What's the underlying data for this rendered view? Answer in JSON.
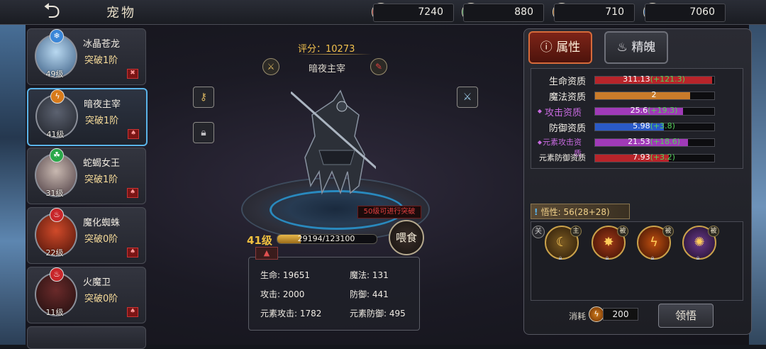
{
  "header": {
    "back_icon": "back-arrow-icon",
    "title": "宠物",
    "resources": [
      {
        "icon": "red-gem-icon",
        "color": "#c8262a",
        "value": "7240"
      },
      {
        "icon": "green-gem-icon",
        "color": "#2aa84a",
        "value": "880"
      },
      {
        "icon": "orange-bolt-icon",
        "color": "#d87a1a",
        "value": "710"
      },
      {
        "icon": "blue-snowflake-icon",
        "color": "#3a86d8",
        "value": "7060"
      }
    ]
  },
  "pets": [
    {
      "name": "冰晶苍龙",
      "breakthrough": "突破1阶",
      "level": "49级",
      "element_icon": "ice-icon",
      "element_color": "#3a86d8",
      "selected": false
    },
    {
      "name": "暗夜主宰",
      "breakthrough": "突破1阶",
      "level": "41级",
      "element_icon": "lightning-icon",
      "element_color": "#d87a1a",
      "selected": true
    },
    {
      "name": "蛇蝎女王",
      "breakthrough": "突破1阶",
      "level": "31级",
      "element_icon": "poison-icon",
      "element_color": "#2aa84a",
      "selected": false
    },
    {
      "name": "魔化蜘蛛",
      "breakthrough": "突破0阶",
      "level": "22级",
      "element_icon": "fire-icon",
      "element_color": "#c8262a",
      "selected": false
    },
    {
      "name": "火魔卫",
      "breakthrough": "突破0阶",
      "level": "11级",
      "element_icon": "fire-icon",
      "element_color": "#c8262a",
      "selected": false
    }
  ],
  "center": {
    "score": "评分：10273",
    "pet_name": "暗夜主宰",
    "weapon_icon_left": "sword-medal-icon",
    "weapon_icon_right": "red-claw-medal-icon",
    "key_icon": "key-icon",
    "lock_icon": "padlock-icon",
    "blade_icon": "blade-icon",
    "warning": "50级可进行突破",
    "level": "41级",
    "xp_text": "29194/123100",
    "xp_progress": 0.237,
    "feed_label": "喂食",
    "stats": [
      {
        "label": "生命: 19651"
      },
      {
        "label": "魔法: 131"
      },
      {
        "label": "攻击: 2000"
      },
      {
        "label": "防御: 441"
      },
      {
        "label": "元素攻击: 1782"
      },
      {
        "label": "元素防御: 495"
      }
    ]
  },
  "right": {
    "tab_attr": "属性",
    "tab_soul": "精魄",
    "attributes": [
      {
        "label": "生命资质",
        "base": "311.13",
        "plus": "(+121.3)",
        "fill": 0.98,
        "color": "#b8242a",
        "diamond": false,
        "small": false
      },
      {
        "label": "魔法资质",
        "base": "2",
        "plus": "",
        "fill": 0.8,
        "color": "#c97b2a",
        "diamond": false,
        "small": false
      },
      {
        "label": "攻击资质",
        "base": "25.6",
        "plus": "(+19.3)",
        "fill": 0.74,
        "color": "#a03ab8",
        "diamond": true,
        "small": false
      },
      {
        "label": "防御资质",
        "base": "5.98",
        "plus": "(+3.8)",
        "fill": 0.58,
        "color": "#2a5ac8",
        "diamond": false,
        "small": false
      },
      {
        "label": "元素攻击资质",
        "base": "21.53",
        "plus": "(+18.6)",
        "fill": 0.78,
        "color": "#a03ab8",
        "diamond": true,
        "small": true
      },
      {
        "label": "元素防御资质",
        "base": "7.93",
        "plus": "(+3.2)",
        "fill": 0.62,
        "color": "#b8242a",
        "diamond": false,
        "small": true
      }
    ],
    "wuxing": "悟性: 56(28+28)",
    "guan": "关",
    "skills": [
      {
        "icon": "crescent-moon-skill-icon",
        "tag": "主",
        "bg": "#5b3a12"
      },
      {
        "icon": "claw-strike-skill-icon",
        "tag": "被",
        "bg": "#6b2410"
      },
      {
        "icon": "lightning-skill-icon",
        "tag": "被",
        "bg": "#7a2a08"
      },
      {
        "icon": "fire-field-skill-icon",
        "tag": "被",
        "bg": "#3a2a5a"
      }
    ],
    "cost_label": "消耗",
    "cost_value": "200",
    "lingwu_label": "领悟"
  }
}
